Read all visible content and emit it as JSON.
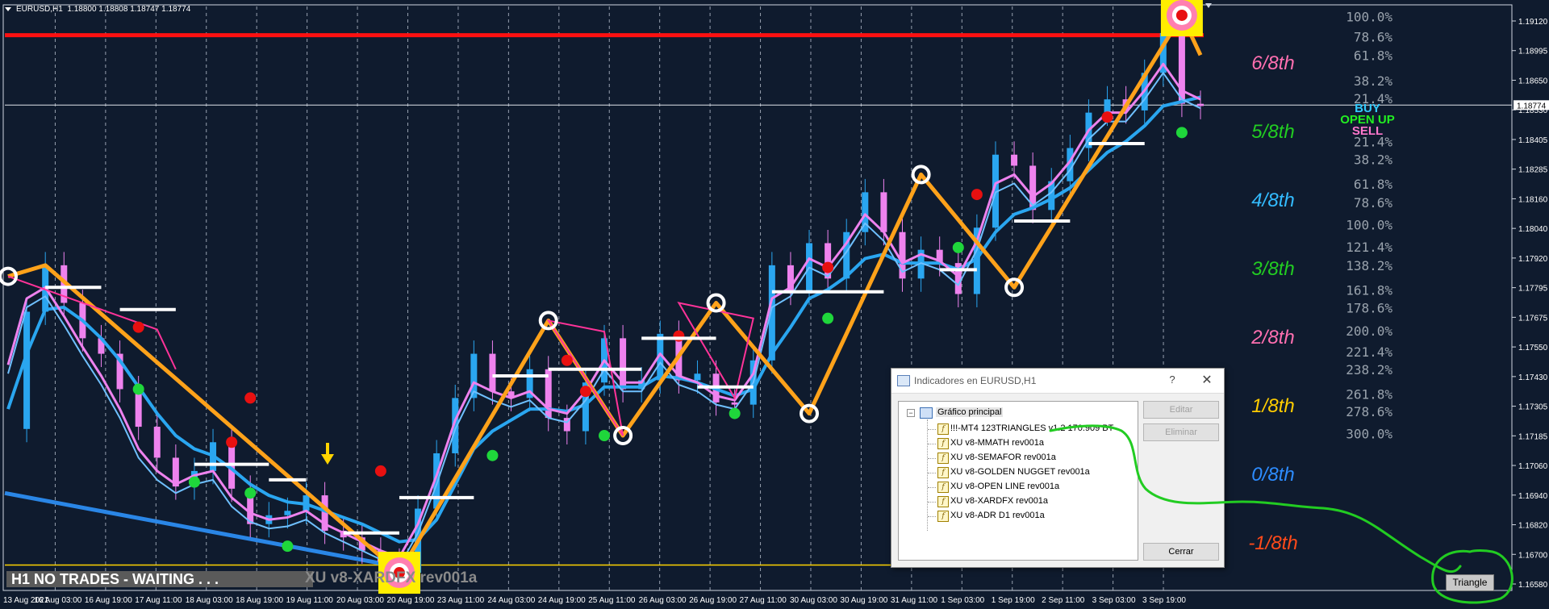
{
  "chart_header": {
    "symbol": "EURUSD,H1",
    "ohlc": "1.18800 1.18808 1.18747 1.18774"
  },
  "colors": {
    "background": "#0f1b2e",
    "grid": "#b9c2d0",
    "axis_text": "#ffffff",
    "resistance": "#ff1010",
    "zigzag": "#ffa21a",
    "ma_fast": "#6fc0ff",
    "ma_slow": "#2aa6f0",
    "ma_pink": "#ee82ee",
    "bull_candle": "#2aa6f0",
    "bear_candle": "#ee82ee",
    "semafor_up": "#e81010",
    "semafor_down": "#1fd63b",
    "triangle_line": "#ff3399",
    "target_box": "#ffee00",
    "annotation_green": "#22cc22"
  },
  "chart_data": {
    "type": "line",
    "title": "EURUSD,H1",
    "ylim": [
      1.1658,
      1.1922
    ],
    "y_ticks": [
      "1.19120",
      "1.18995",
      "1.18650",
      "1.18530",
      "1.18405",
      "1.18285",
      "1.18160",
      "1.18040",
      "1.17920",
      "1.17795",
      "1.17675",
      "1.17550",
      "1.17430",
      "1.17305",
      "1.17185",
      "1.17060",
      "1.16940",
      "1.16820",
      "1.16700",
      "1.16580"
    ],
    "current_price": "1.18774",
    "x_ticks": [
      "13 Aug 2021",
      "16 Aug 03:00",
      "16 Aug 19:00",
      "17 Aug 11:00",
      "18 Aug 03:00",
      "18 Aug 19:00",
      "19 Aug 11:00",
      "20 Aug 03:00",
      "20 Aug 19:00",
      "23 Aug 11:00",
      "24 Aug 03:00",
      "24 Aug 19:00",
      "25 Aug 11:00",
      "26 Aug 03:00",
      "26 Aug 19:00",
      "27 Aug 11:00",
      "30 Aug 03:00",
      "30 Aug 19:00",
      "31 Aug 11:00",
      "1 Sep 03:00",
      "1 Sep 19:00",
      "2 Sep 11:00",
      "3 Sep 03:00",
      "3 Sep 19:00"
    ],
    "resistance_level": 1.1909,
    "support_level": 1.16695,
    "series": [
      {
        "name": "price",
        "values": [
          1.1731,
          1.1784,
          1.1805,
          1.1788,
          1.1772,
          1.1765,
          1.1749,
          1.1732,
          1.1718,
          1.1705,
          1.1712,
          1.1725,
          1.1704,
          1.1688,
          1.1692,
          1.1694,
          1.1701,
          1.1685,
          1.1682,
          1.1676,
          1.1671,
          1.1666,
          1.1695,
          1.172,
          1.1745,
          1.1765,
          1.1748,
          1.1745,
          1.1758,
          1.1736,
          1.173,
          1.1752,
          1.1772,
          1.1749,
          1.1753,
          1.1774,
          1.1753,
          1.1756,
          1.1743,
          1.1742,
          1.1762,
          1.1805,
          1.1793,
          1.1815,
          1.1799,
          1.182,
          1.1838,
          1.182,
          1.1799,
          1.1812,
          1.1806,
          1.1792,
          1.1822,
          1.1855,
          1.185,
          1.183,
          1.1843,
          1.1858,
          1.1874,
          1.188,
          1.1875,
          1.1892,
          1.191,
          1.1878,
          1.1877
        ]
      },
      {
        "name": "ma_fast",
        "values": [
          1.176,
          1.179,
          1.1795,
          1.1782,
          1.1768,
          1.1755,
          1.174,
          1.1722,
          1.1712,
          1.1706,
          1.171,
          1.1712,
          1.17,
          1.1693,
          1.169,
          1.1691,
          1.1694,
          1.1688,
          1.1684,
          1.168,
          1.1676,
          1.1673,
          1.1688,
          1.171,
          1.1735,
          1.1752,
          1.1748,
          1.1745,
          1.1748,
          1.174,
          1.1738,
          1.1748,
          1.1762,
          1.1752,
          1.1752,
          1.1765,
          1.1755,
          1.1752,
          1.1746,
          1.1744,
          1.1756,
          1.179,
          1.1795,
          1.1808,
          1.1804,
          1.1815,
          1.1828,
          1.182,
          1.1806,
          1.181,
          1.1807,
          1.18,
          1.1816,
          1.1842,
          1.1846,
          1.1836,
          1.1842,
          1.1852,
          1.1866,
          1.1874,
          1.1874,
          1.1884,
          1.1896,
          1.1884,
          1.188
        ]
      },
      {
        "name": "ma_slow",
        "values": [
          1.174,
          1.1765,
          1.1785,
          1.1786,
          1.178,
          1.1772,
          1.1762,
          1.175,
          1.1738,
          1.1728,
          1.1722,
          1.1719,
          1.1713,
          1.1706,
          1.1701,
          1.1698,
          1.1697,
          1.1694,
          1.1691,
          1.1688,
          1.1684,
          1.168,
          1.1681,
          1.169,
          1.1706,
          1.1722,
          1.173,
          1.1735,
          1.174,
          1.174,
          1.1739,
          1.1742,
          1.175,
          1.175,
          1.175,
          1.1755,
          1.1754,
          1.1752,
          1.1749,
          1.1746,
          1.1749,
          1.1765,
          1.1777,
          1.179,
          1.1794,
          1.18,
          1.1808,
          1.181,
          1.1806,
          1.1806,
          1.1806,
          1.1803,
          1.1808,
          1.182,
          1.1828,
          1.1831,
          1.1835,
          1.184,
          1.1848,
          1.1856,
          1.1861,
          1.1868,
          1.1877,
          1.1879,
          1.1881
        ]
      }
    ],
    "zigzag": [
      [
        0,
        1.18
      ],
      [
        2,
        1.1805
      ],
      [
        21,
        1.1666
      ],
      [
        29,
        1.178
      ],
      [
        33,
        1.1728
      ],
      [
        38,
        1.1788
      ],
      [
        43,
        1.1738
      ],
      [
        49,
        1.1846
      ],
      [
        54,
        1.1795
      ],
      [
        63,
        1.1918
      ],
      [
        64,
        1.19
      ]
    ],
    "murrey_labels": [
      {
        "label": "6/8th",
        "color": "#ff6fb0",
        "price": 1.18965
      },
      {
        "label": "5/8th",
        "color": "#22cc22",
        "price": 1.18655
      },
      {
        "label": "4/8th",
        "color": "#33bbff",
        "price": 1.18345
      },
      {
        "label": "3/8th",
        "color": "#22cc22",
        "price": 1.18035
      },
      {
        "label": "2/8th",
        "color": "#ff6fb0",
        "price": 1.17725
      },
      {
        "label": "1/8th",
        "color": "#ffcc00",
        "price": 1.17415
      },
      {
        "label": "0/8th",
        "color": "#2d8cff",
        "price": 1.17105
      },
      {
        "label": "-1/8th",
        "color": "#ff4a1a",
        "price": 1.16795
      }
    ],
    "fib_labels": [
      {
        "label": "100.0%",
        "price": 1.1917
      },
      {
        "label": "78.6%",
        "price": 1.1908
      },
      {
        "label": "61.8%",
        "price": 1.18995
      },
      {
        "label": "38.2%",
        "price": 1.1888
      },
      {
        "label": "21.4%",
        "price": 1.188
      },
      {
        "label": "21.4%",
        "price": 1.18605
      },
      {
        "label": "38.2%",
        "price": 1.18525
      },
      {
        "label": "61.8%",
        "price": 1.18415
      },
      {
        "label": "78.6%",
        "price": 1.1833
      },
      {
        "label": "100.0%",
        "price": 1.1823
      },
      {
        "label": "121.4%",
        "price": 1.1813
      },
      {
        "label": "138.2%",
        "price": 1.18045
      },
      {
        "label": "161.8%",
        "price": 1.17935
      },
      {
        "label": "178.6%",
        "price": 1.17855
      },
      {
        "label": "200.0%",
        "price": 1.1775
      },
      {
        "label": "221.4%",
        "price": 1.17655
      },
      {
        "label": "238.2%",
        "price": 1.17575
      },
      {
        "label": "261.8%",
        "price": 1.17465
      },
      {
        "label": "278.6%",
        "price": 1.17385
      },
      {
        "label": "300.0%",
        "price": 1.17285
      }
    ],
    "signals": [
      {
        "label": "BUY",
        "color": "#33ccff"
      },
      {
        "label": "OPEN UP",
        "color": "#22ee22"
      },
      {
        "label": "SELL",
        "color": "#ff77cc"
      }
    ]
  },
  "status_banner": "H1  NO TRADES - WAITING . . .",
  "watermark": "XU v8-XARDFX rev001a",
  "dialog": {
    "title": "Indicadores en EURUSD,H1",
    "help": "?",
    "close": "✕",
    "tree_root": "Gráfico principal",
    "items": [
      "!!!-MT4 123TRIANGLES v1.2  170.909 BT",
      "XU v8-MMATH rev001a",
      "XU v8-SEMAFOR rev001a",
      "XU v8-GOLDEN NUGGET rev001a",
      "XU v8-OPEN LINE rev001a",
      "XU v8-XARDFX rev001a",
      "XU v8-ADR D1 rev001a"
    ],
    "edit_button": "Editar",
    "delete_button": "Eliminar",
    "close_button": "Cerrar"
  },
  "triangle_button": "Triangle"
}
